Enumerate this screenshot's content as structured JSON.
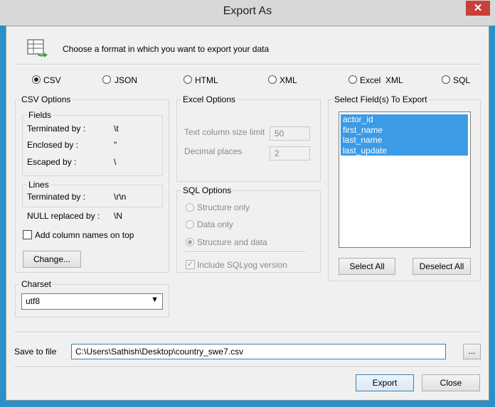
{
  "window": {
    "title": "Export As",
    "close_glyph": "✕"
  },
  "header": {
    "icon": "export-table-icon",
    "instruction": "Choose a format in which you want to export your data"
  },
  "formats": [
    {
      "label": "CSV",
      "selected": true
    },
    {
      "label": "JSON",
      "selected": false
    },
    {
      "label": "HTML",
      "selected": false
    },
    {
      "label": "XML",
      "selected": false
    },
    {
      "label": "Excel  XML",
      "selected": false
    },
    {
      "label": "SQL",
      "selected": false
    }
  ],
  "csv_options": {
    "title": "CSV Options",
    "fields_title": "Fields",
    "terminated_label": "Terminated by :",
    "terminated_value": "\\t",
    "enclosed_label": "Enclosed by :",
    "enclosed_value": "\"",
    "escaped_label": "Escaped by :",
    "escaped_value": "\\",
    "lines_title": "Lines",
    "lines_terminated_label": "Terminated by :",
    "lines_terminated_value": "\\r\\n",
    "null_label": "NULL replaced by :",
    "null_value": "\\N",
    "add_columns_label": "Add column names on top",
    "add_columns_checked": false,
    "change_button": "Change..."
  },
  "excel_options": {
    "title": "Excel Options",
    "col_size_label": "Text column size limit",
    "col_size_value": "50",
    "decimal_label": "Decimal places",
    "decimal_value": "2"
  },
  "sql_options": {
    "title": "SQL Options",
    "structure_only": "Structure only",
    "data_only": "Data only",
    "structure_and_data": "Structure and data",
    "selected": "structure_and_data",
    "include_sqlyog": "Include SQLyog version",
    "include_checked": true
  },
  "fields": {
    "title": "Select Field(s) To Export",
    "items": [
      "actor_id",
      "first_name",
      "last_name",
      "last_update"
    ],
    "select_all": "Select All",
    "deselect_all": "Deselect All"
  },
  "charset": {
    "title": "Charset",
    "value": "utf8"
  },
  "save": {
    "label": "Save to file",
    "value": "C:\\Users\\Sathish\\Desktop\\country_swe7.csv",
    "browse": "..."
  },
  "buttons": {
    "export": "Export",
    "close": "Close"
  },
  "colors": {
    "selection": "#3b9be6",
    "accent": "#2b8fc8",
    "close": "#c8403a"
  }
}
